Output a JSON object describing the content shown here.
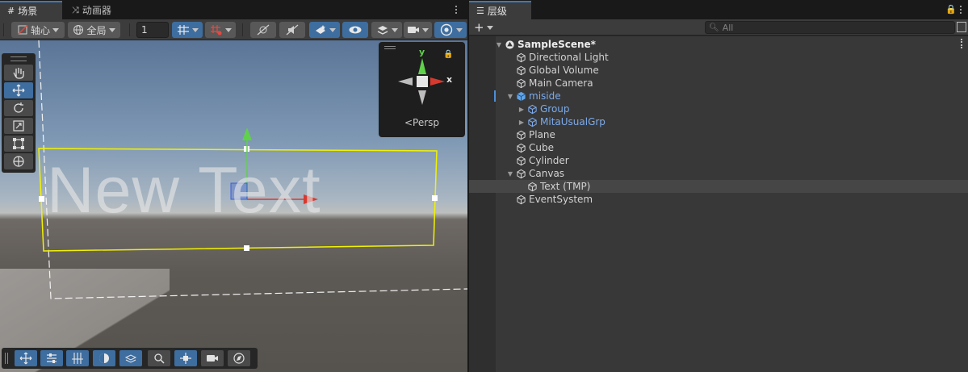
{
  "scene_window": {
    "tabs": [
      {
        "label": "场景",
        "icon": "grid-icon",
        "active": true
      },
      {
        "label": "动画器",
        "icon": "animator-icon",
        "active": false
      }
    ],
    "toolbar": {
      "pivot_label": "轴心",
      "global_label": "全局",
      "grid_snap_value": "1"
    },
    "scene_text": "New Text",
    "gizmo": {
      "y_label": "y",
      "x_label": "x",
      "projection_label": "<Persp"
    }
  },
  "hierarchy_window": {
    "tab_label": "层级",
    "search_placeholder": "All",
    "items": [
      {
        "label": "SampleScene*",
        "depth": 0,
        "fold": "expanded",
        "type": "scene"
      },
      {
        "label": "Directional Light",
        "depth": 1,
        "fold": "none",
        "type": "object"
      },
      {
        "label": "Global Volume",
        "depth": 1,
        "fold": "none",
        "type": "object"
      },
      {
        "label": "Main Camera",
        "depth": 1,
        "fold": "none",
        "type": "object"
      },
      {
        "label": "miside",
        "depth": 1,
        "fold": "expanded",
        "type": "prefab-root"
      },
      {
        "label": "Group",
        "depth": 2,
        "fold": "collapsed",
        "type": "prefab"
      },
      {
        "label": "MitaUsualGrp",
        "depth": 2,
        "fold": "collapsed",
        "type": "prefab"
      },
      {
        "label": "Plane",
        "depth": 1,
        "fold": "none",
        "type": "object"
      },
      {
        "label": "Cube",
        "depth": 1,
        "fold": "none",
        "type": "object"
      },
      {
        "label": "Cylinder",
        "depth": 1,
        "fold": "none",
        "type": "object"
      },
      {
        "label": "Canvas",
        "depth": 1,
        "fold": "expanded",
        "type": "object"
      },
      {
        "label": "Text (TMP)",
        "depth": 2,
        "fold": "none",
        "type": "object",
        "selected": true
      },
      {
        "label": "EventSystem",
        "depth": 1,
        "fold": "none",
        "type": "object"
      }
    ]
  },
  "colors": {
    "accent": "#3e6d9f",
    "selection_outline": "#f2f200",
    "prefab_text": "#7caaea",
    "axis_x": "#d63a2f",
    "axis_y": "#5fd14a",
    "axis_z": "#3a5fd6"
  }
}
